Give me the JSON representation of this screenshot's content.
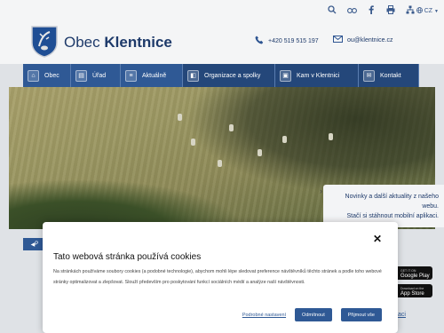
{
  "topbar": {
    "icons": [
      "search-icon",
      "accessibility-icon",
      "facebook-icon",
      "print-icon",
      "sitemap-icon"
    ],
    "lang_label": "CZ"
  },
  "header": {
    "title_light": "Obec",
    "title_bold": "Klentnice",
    "phone": "+420 519 515 197",
    "email": "ou@klentnice.cz"
  },
  "nav": {
    "items": [
      {
        "label": "Obec",
        "icon": "home-icon"
      },
      {
        "label": "Úřad",
        "icon": "office-icon"
      },
      {
        "label": "Aktuálně",
        "icon": "news-icon"
      },
      {
        "label": "Organizace a spolky",
        "icon": "organizations-icon"
      },
      {
        "label": "Kam v Klentnici",
        "icon": "places-icon"
      },
      {
        "label": "Kontakt",
        "icon": "contact-icon"
      }
    ]
  },
  "app_panel": {
    "line1": "Novinky a další aktuality z našeho",
    "line2": "webu.",
    "line3": "Stačí si stáhnout mobilní aplikaci.",
    "google_small": "GET IT ON",
    "google_label": "Google Play",
    "apple_small": "Download on the",
    "apple_label": "App Store",
    "link_fragment": "aci"
  },
  "pc_button_label": "P",
  "cookie": {
    "title": "Tato webová stránka používá cookies",
    "text": "Na stránkách používáme soubory cookies (a podobné technologie), abychom mohli lépe sledovat preference návštěvníků těchto stránek a podle toho webové stránky optimalizovat a zlepšovat. Slouží především pro poskytování funkcí sociálních médií a analýze naší návštěvnosti.",
    "settings_label": "Podrobné nastavení",
    "reject_label": "Odmítnout",
    "accept_label": "Přijmout vše"
  },
  "colors": {
    "brand_blue": "#2f5995",
    "nav_dark": "#24477a",
    "title_blue": "#1e3a6a"
  }
}
